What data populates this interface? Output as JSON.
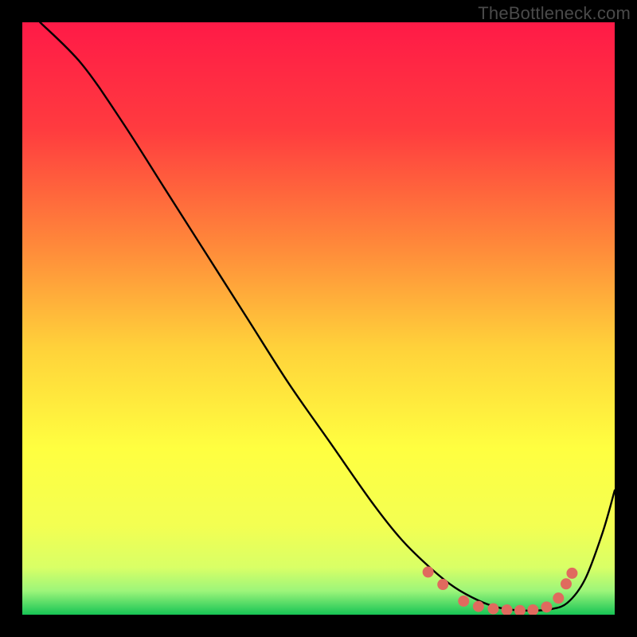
{
  "watermark": "TheBottleneck.com",
  "chart_data": {
    "type": "line",
    "title": "",
    "xlabel": "",
    "ylabel": "",
    "xlim": [
      0,
      1
    ],
    "ylim": [
      0,
      1
    ],
    "grid": false,
    "legend": false,
    "background_gradient_stops": [
      {
        "offset": 0.0,
        "color": "#ff1a47"
      },
      {
        "offset": 0.18,
        "color": "#ff3b3f"
      },
      {
        "offset": 0.38,
        "color": "#ff8a3a"
      },
      {
        "offset": 0.55,
        "color": "#ffd23a"
      },
      {
        "offset": 0.72,
        "color": "#ffff40"
      },
      {
        "offset": 0.85,
        "color": "#f3ff52"
      },
      {
        "offset": 0.92,
        "color": "#d9ff66"
      },
      {
        "offset": 0.96,
        "color": "#9cf57a"
      },
      {
        "offset": 1.0,
        "color": "#17c455"
      }
    ],
    "series": [
      {
        "name": "bottleneck-curve",
        "x": [
          0.03,
          0.1,
          0.17,
          0.24,
          0.31,
          0.38,
          0.45,
          0.52,
          0.59,
          0.64,
          0.69,
          0.73,
          0.77,
          0.8,
          0.83,
          0.86,
          0.89,
          0.92,
          0.95,
          0.98,
          1.0
        ],
        "y": [
          1.0,
          0.93,
          0.83,
          0.72,
          0.61,
          0.5,
          0.39,
          0.29,
          0.19,
          0.127,
          0.078,
          0.046,
          0.024,
          0.013,
          0.008,
          0.007,
          0.009,
          0.02,
          0.06,
          0.14,
          0.21
        ],
        "color": "#000000",
        "width": 2.4
      }
    ],
    "markers": {
      "name": "optimal-range-markers",
      "color": "#e06a5e",
      "radius": 7,
      "points": [
        {
          "x": 0.685,
          "y": 0.072
        },
        {
          "x": 0.71,
          "y": 0.051
        },
        {
          "x": 0.745,
          "y": 0.023
        },
        {
          "x": 0.77,
          "y": 0.014
        },
        {
          "x": 0.795,
          "y": 0.01
        },
        {
          "x": 0.818,
          "y": 0.008
        },
        {
          "x": 0.84,
          "y": 0.007
        },
        {
          "x": 0.862,
          "y": 0.008
        },
        {
          "x": 0.885,
          "y": 0.013
        },
        {
          "x": 0.905,
          "y": 0.028
        },
        {
          "x": 0.918,
          "y": 0.052
        },
        {
          "x": 0.928,
          "y": 0.07
        }
      ]
    }
  }
}
